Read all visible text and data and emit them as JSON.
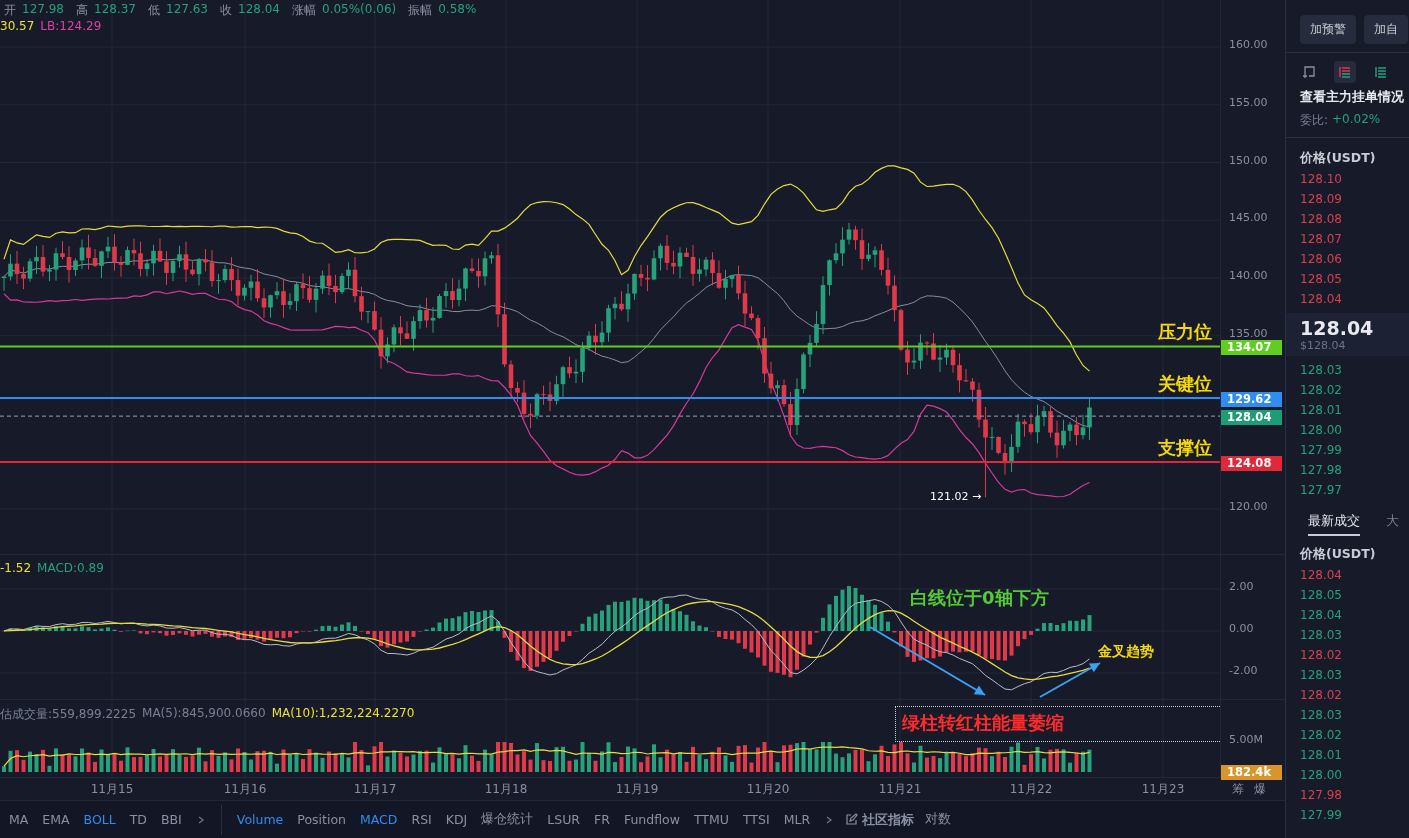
{
  "ohlc": [
    {
      "label": "开",
      "value": "127.98"
    },
    {
      "label": "高",
      "value": "128.37"
    },
    {
      "label": "低",
      "value": "127.63"
    },
    {
      "label": "收",
      "value": "128.04"
    },
    {
      "label": "涨幅",
      "value": "0.05%(0.06)"
    },
    {
      "label": "振幅",
      "value": "0.58%"
    }
  ],
  "boll_legend": [
    {
      "text": "30.57",
      "color": "#f0e130"
    },
    {
      "text": "LB:124.29",
      "color": "#e040a0"
    }
  ],
  "price_axis": {
    "ticks": [
      "160.00",
      "155.00",
      "150.00",
      "145.00",
      "140.00",
      "135.00",
      "120.00"
    ]
  },
  "price_lines": [
    {
      "kind": "resistance",
      "label": "压力位",
      "tag": "134.07"
    },
    {
      "kind": "key",
      "label": "关键位",
      "tag": "129.62"
    },
    {
      "kind": "current",
      "tag": "128.04"
    },
    {
      "kind": "support",
      "label": "支撑位",
      "tag": "124.08"
    }
  ],
  "low_marker": "121.02 →",
  "macd": {
    "legend": [
      {
        "text": "-1.52",
        "color": "#f0e130"
      },
      {
        "text": "MACD:0.89",
        "color": "#26a17b"
      }
    ],
    "ticks": [
      "2.00",
      "0.00",
      "-2.00"
    ],
    "notes": [
      {
        "text": "白线位于0轴下方",
        "color": "#55c936"
      },
      {
        "text": "金叉趋势",
        "color": "#f5d90a"
      }
    ]
  },
  "volume": {
    "legend": [
      {
        "text": "估成交量:559,899.2225",
        "color": "#7a8094"
      },
      {
        "text": "MA(5):845,900.0660",
        "color": "#7a8094"
      },
      {
        "text": "MA(10):1,232,224.2270",
        "color": "#f0e130"
      }
    ],
    "ticks": [
      "5.00M"
    ],
    "tag": "182.4k",
    "note": "绿柱转红柱能量萎缩"
  },
  "dates": [
    "11月15",
    "11月16",
    "11月17",
    "11月18",
    "11月19",
    "11月20",
    "11月21",
    "11月22",
    "11月23"
  ],
  "axis_corner": [
    "筹",
    "爆"
  ],
  "toolbar": {
    "main": [
      {
        "label": "MA",
        "selected": false
      },
      {
        "label": "EMA",
        "selected": false
      },
      {
        "label": "BOLL",
        "selected": true
      },
      {
        "label": "TD",
        "selected": false
      },
      {
        "label": "BBI",
        "selected": false
      }
    ],
    "sub": [
      {
        "label": "Volume",
        "selected": true
      },
      {
        "label": "Position",
        "selected": false
      },
      {
        "label": "MACD",
        "selected": true
      },
      {
        "label": "RSI",
        "selected": false
      },
      {
        "label": "KDJ",
        "selected": false
      },
      {
        "label": "爆仓统计",
        "selected": false
      },
      {
        "label": "LSUR",
        "selected": false
      },
      {
        "label": "FR",
        "selected": false
      },
      {
        "label": "Fundflow",
        "selected": false
      },
      {
        "label": "TTMU",
        "selected": false
      },
      {
        "label": "TTSI",
        "selected": false
      },
      {
        "label": "MLR",
        "selected": false
      }
    ],
    "community": "社区指标",
    "log": "对数"
  },
  "right": {
    "buttons": [
      "加预警",
      "加自"
    ],
    "layout_buttons": [
      {
        "selected": false
      },
      {
        "selected": true
      },
      {
        "selected": false
      }
    ],
    "depth_link": "查看主力挂单情况",
    "ratio_label": "委比:",
    "ratio_value": "+0.02%",
    "price_header": "价格(USDT)",
    "asks": [
      "128.10",
      "128.09",
      "128.08",
      "128.07",
      "128.06",
      "128.05",
      "128.04"
    ],
    "last_price": "128.04",
    "last_price_usd": "$128.04",
    "bids": [
      "128.03",
      "128.02",
      "128.01",
      "128.00",
      "127.99",
      "127.98",
      "127.97"
    ],
    "trade_tabs": [
      {
        "label": "最新成交",
        "selected": true
      },
      {
        "label": "大",
        "selected": false
      }
    ],
    "trades_header": "价格(USDT)",
    "trades": [
      {
        "price": "128.04",
        "color": "#d8414c"
      },
      {
        "price": "128.05",
        "color": "#26a17b"
      },
      {
        "price": "128.04",
        "color": "#26a17b"
      },
      {
        "price": "128.03",
        "color": "#26a17b"
      },
      {
        "price": "128.02",
        "color": "#d8414c"
      },
      {
        "price": "128.03",
        "color": "#26a17b"
      },
      {
        "price": "128.02",
        "color": "#d8414c"
      },
      {
        "price": "128.03",
        "color": "#26a17b"
      },
      {
        "price": "128.02",
        "color": "#26a17b"
      },
      {
        "price": "128.01",
        "color": "#26a17b"
      },
      {
        "price": "128.00",
        "color": "#26a17b"
      },
      {
        "price": "127.98",
        "color": "#d8414c"
      },
      {
        "price": "127.99",
        "color": "#26a17b"
      }
    ]
  }
}
